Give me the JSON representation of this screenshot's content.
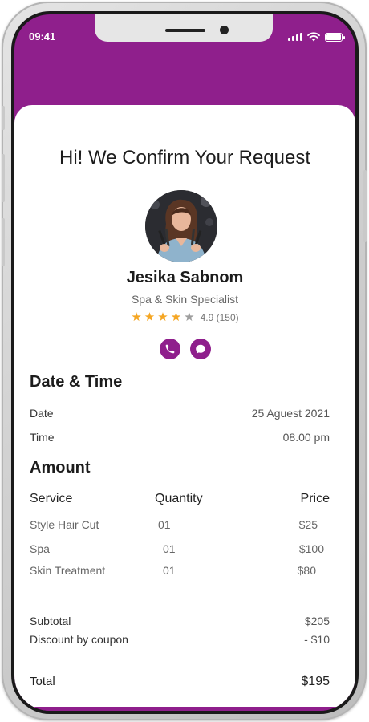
{
  "status_bar": {
    "time": "09:41"
  },
  "header": {
    "title": "Hi! We Confirm Your Request"
  },
  "specialist": {
    "name": "Jesika Sabnom",
    "role": "Spa & Skin Specialist",
    "rating": 4,
    "rating_max": 5,
    "rating_text": "4.9 (150)"
  },
  "date_time": {
    "title": "Date & Time",
    "date_label": "Date",
    "date_value": "25 Aguest 2021",
    "time_label": "Time",
    "time_value": "08.00 pm"
  },
  "amount": {
    "title": "Amount",
    "columns": {
      "service": "Service",
      "quantity": "Quantity",
      "price": "Price"
    },
    "items": [
      {
        "service": "Style Hair Cut",
        "quantity": "01",
        "price": "$25"
      },
      {
        "service": "Spa",
        "quantity": "01",
        "price": "$100"
      },
      {
        "service": "Skin Treatment",
        "quantity": "01",
        "price": "$80"
      }
    ],
    "subtotal_label": "Subtotal",
    "subtotal_value": "$205",
    "discount_label": "Discount by coupon",
    "discount_value": "- $10",
    "total_label": "Total",
    "total_value": "$195"
  },
  "colors": {
    "primary": "#8f1f8c",
    "star_on": "#f5a623",
    "star_off": "#9e9e9e"
  }
}
